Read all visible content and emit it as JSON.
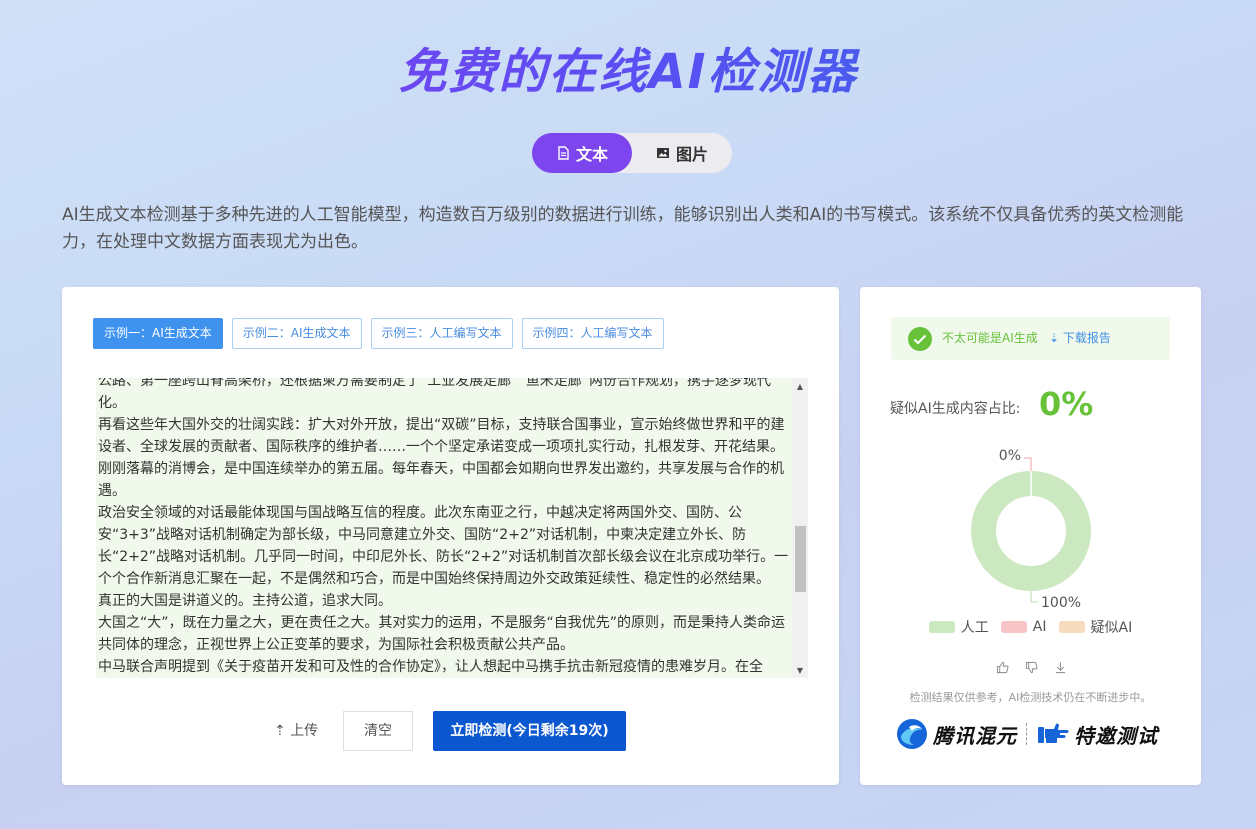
{
  "header": {
    "title": "免费的在线AI检测器"
  },
  "mode_tabs": [
    {
      "label": "文本",
      "icon": "document-icon",
      "active": true
    },
    {
      "label": "图片",
      "icon": "image-icon",
      "active": false
    }
  ],
  "intro": "AI生成文本检测基于多种先进的人工智能模型，构造数百万级别的数据进行训练，能够识别出人类和AI的书写模式。该系统不仅具备优秀的英文检测能力，在处理中文数据方面表现尤为出色。",
  "examples": [
    {
      "label": "示例一：AI生成文本",
      "active": true
    },
    {
      "label": "示例二：AI生成文本",
      "active": false
    },
    {
      "label": "示例三：人工编写文本",
      "active": false
    },
    {
      "label": "示例四：人工编写文本",
      "active": false
    }
  ],
  "input_text": [
    "公路、第一座跨山脊高架桥，还根据柬方需要制定了“工业发展走廊”“鱼米走廊”两份合作规划，携手逐梦现代化。",
    "再看这些年大国外交的壮阔实践：扩大对外开放，提出“双碳”目标，支持联合国事业，宣示始终做世界和平的建设者、全球发展的贡献者、国际秩序的维护者……一个个坚定承诺变成一项项扎实行动，扎根发芽、开花结果。刚刚落幕的消博会，是中国连续举办的第五届。每年春天，中国都会如期向世界发出邀约，共享发展与合作的机遇。",
    "政治安全领域的对话最能体现国与国战略互信的程度。此次东南亚之行，中越决定将两国外交、国防、公安“3+3”战略对话机制确定为部长级，中马同意建立外交、国防“2+2”对话机制，中柬决定建立外长、防长“2+2”战略对话机制。几乎同一时间，中印尼外长、防长“2+2”对话机制首次部长级会议在北京成功举行。一个个合作新消息汇聚在一起，不是偶然和巧合，而是中国始终保持周边外交政策延续性、稳定性的必然结果。",
    "真正的大国是讲道义的。主持公道，追求大同。",
    "大国之“大”，既在力量之大，更在责任之大。其对实力的运用，不是服务“自我优先”的原则，而是秉持人类命运共同体的理念，正视世界上公正变革的要求，为国际社会积极贡献公共产品。",
    "中马联合声明提到《关于疫苗开发和可及性的合作协定》，让人想起中马携手抗击新冠疫情的患难岁月。在全"
  ],
  "actions": {
    "upload_label": "上传",
    "clear_label": "清空",
    "detect_label": "立即检测(今日剩余19次)"
  },
  "result": {
    "status_text": "不太可能是AI生成",
    "download_label": "下载报告",
    "ratio_label": "疑似AI生成内容占比:",
    "ratio_value": "0%",
    "feedback_icons": [
      "thumbs-up-icon",
      "thumbs-down-icon",
      "download-icon"
    ],
    "disclaimer": "检测结果仅供参考，AI检测技术仍在不断进步中。",
    "brand_left": "腾讯混元",
    "brand_right": "特邀测试"
  },
  "chart_data": {
    "type": "pie",
    "categories": [
      "人工",
      "AI",
      "疑似AI"
    ],
    "values": [
      100,
      0,
      0
    ],
    "data_labels": [
      "100%",
      "0%"
    ],
    "colors": [
      "#cce8c0",
      "#f7c5c6",
      "#f5dcbf"
    ],
    "legend": "bottom"
  }
}
